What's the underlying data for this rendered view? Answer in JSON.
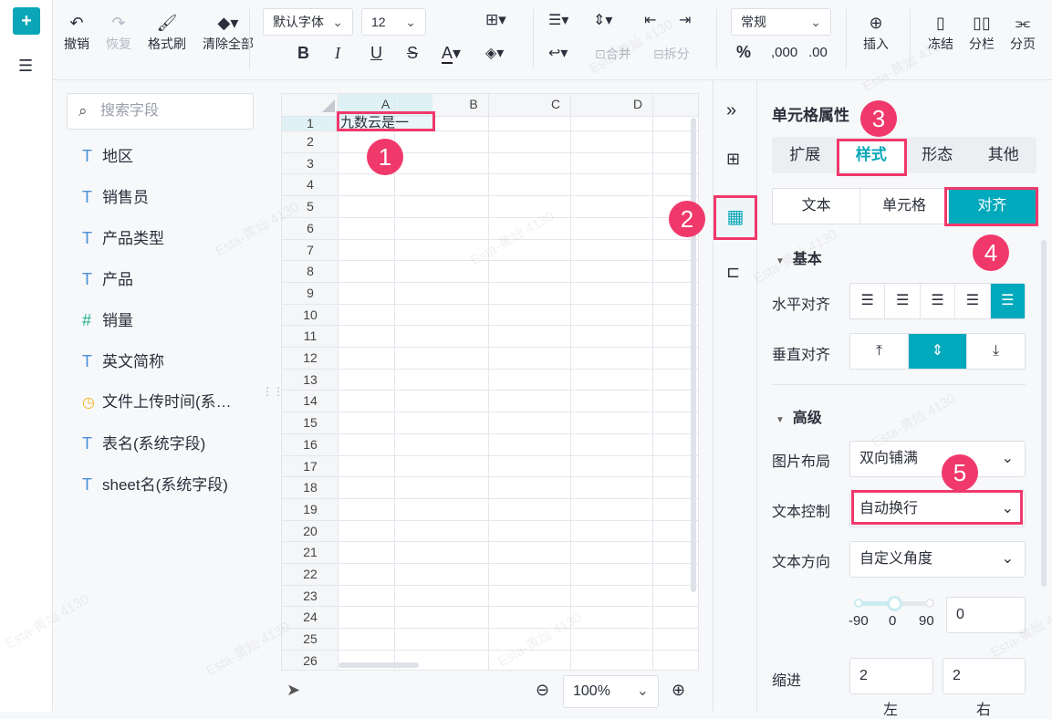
{
  "toolbar": {
    "undo": "撤销",
    "redo": "恢复",
    "format_painter": "格式刷",
    "clear_all": "清除全部",
    "font": "默认字体",
    "font_size": "12",
    "merge": "合并",
    "split": "拆分",
    "number_format": "常规",
    "percent": "%",
    "thousands": ",000",
    "decimals": ".00",
    "insert": "插入",
    "freeze": "冻结",
    "columns": "分栏",
    "page_break": "分页"
  },
  "fields": {
    "search_placeholder": "搜索字段",
    "items": [
      {
        "type": "T",
        "label": "地区"
      },
      {
        "type": "T",
        "label": "销售员"
      },
      {
        "type": "T",
        "label": "产品类型"
      },
      {
        "type": "T",
        "label": "产品"
      },
      {
        "type": "#",
        "label": "销量"
      },
      {
        "type": "T",
        "label": "英文简称"
      },
      {
        "type": "time",
        "label": "文件上传时间(系…"
      },
      {
        "type": "T",
        "label": "表名(系统字段)"
      },
      {
        "type": "T",
        "label": "sheet名(系统字段)"
      }
    ]
  },
  "sheet": {
    "columns": [
      "A",
      "B",
      "C",
      "D"
    ],
    "rows": [
      "1",
      "2",
      "3",
      "4",
      "5",
      "6",
      "7",
      "8",
      "9",
      "10",
      "11",
      "12",
      "13",
      "14",
      "15",
      "16",
      "17",
      "18",
      "19",
      "20",
      "21",
      "22",
      "23",
      "24",
      "25",
      "26"
    ],
    "cell_a1": "九数云是一",
    "zoom": "100%"
  },
  "panel": {
    "title": "单元格属性",
    "tabs": [
      "扩展",
      "样式",
      "形态",
      "其他"
    ],
    "active_tab": "样式",
    "subtabs": [
      "文本",
      "单元格",
      "对齐"
    ],
    "active_subtab": "对齐",
    "basic": "基本",
    "h_align": "水平对齐",
    "v_align": "垂直对齐",
    "advanced": "高级",
    "image_layout_label": "图片布局",
    "image_layout": "双向铺满",
    "text_control_label": "文本控制",
    "text_control": "自动换行",
    "text_direction_label": "文本方向",
    "text_direction": "自定义角度",
    "angle_min": "-90",
    "angle_mid": "0",
    "angle_max": "90",
    "angle_value": "0",
    "indent_label": "缩进",
    "indent_left": "2",
    "indent_right": "2",
    "left": "左",
    "right": "右"
  },
  "annotations": [
    "1",
    "2",
    "3",
    "4",
    "5"
  ],
  "watermark": "Esta-黄灿 4130",
  "colors": {
    "accent": "#00a9bc",
    "annotation": "#f0386b"
  }
}
